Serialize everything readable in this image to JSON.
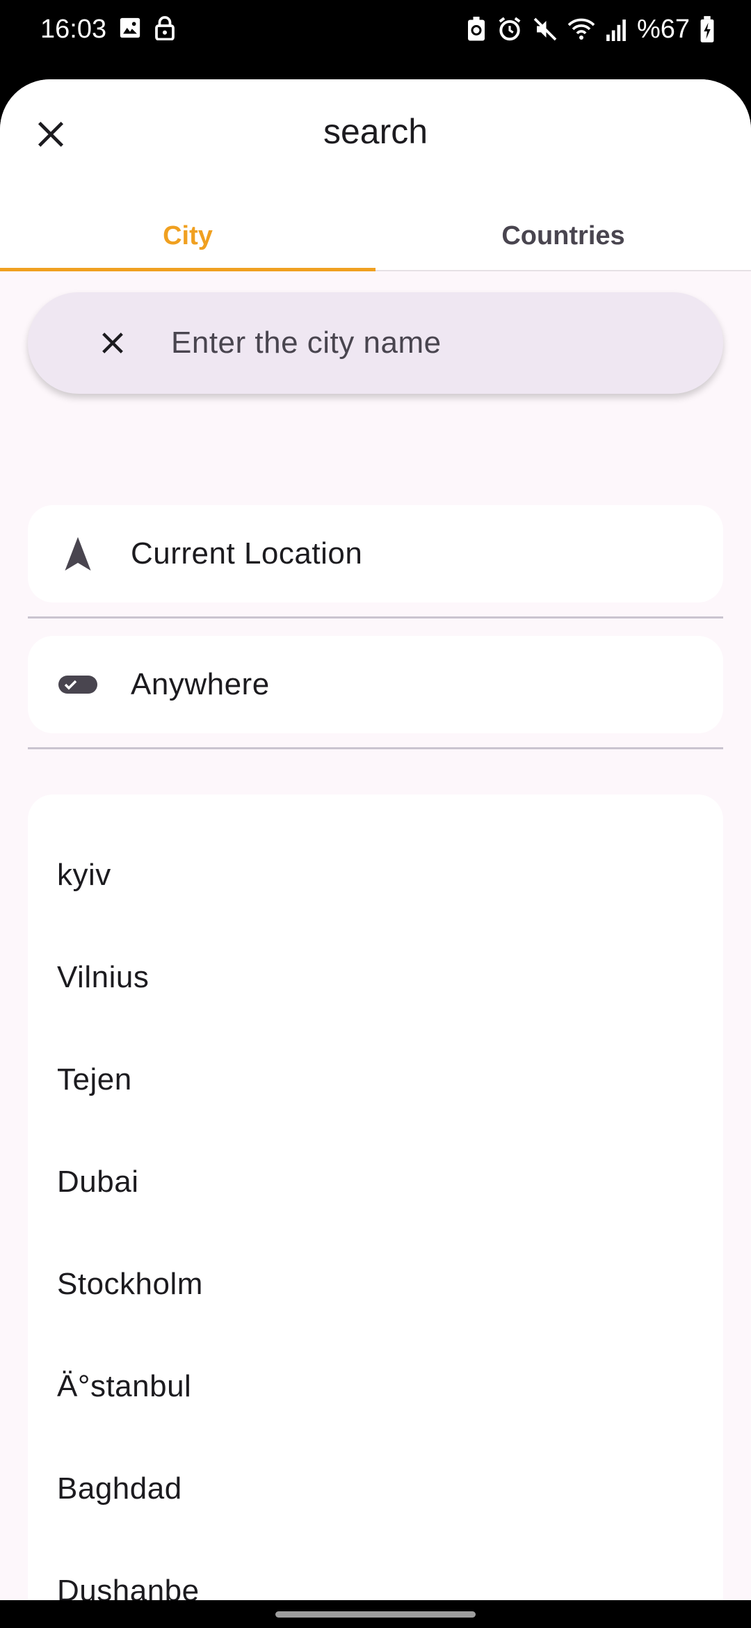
{
  "status_bar": {
    "time": "16:03",
    "battery": "%67",
    "left_icons": [
      "image-icon",
      "lock-icon"
    ],
    "right_icons": [
      "data-saver-icon",
      "alarm-icon",
      "mute-icon",
      "wifi-icon",
      "signal-icon",
      "battery-charging-icon"
    ]
  },
  "sheet": {
    "title": "search",
    "close_icon": "close-icon"
  },
  "tabs": [
    {
      "label": "City",
      "active": true
    },
    {
      "label": "Countries",
      "active": false
    }
  ],
  "search": {
    "placeholder": "Enter the city name",
    "value": "",
    "clear_icon": "close-icon"
  },
  "options": [
    {
      "label": "Current Location",
      "icon": "navigation-arrow-icon"
    },
    {
      "label": "Anywhere",
      "icon": "toggle-icon"
    }
  ],
  "cities": [
    "kyiv",
    "Vilnius",
    "Tejen",
    "Dubai",
    "Stockholm",
    "Ä°stanbul",
    "Baghdad",
    "Dushanbe"
  ],
  "colors": {
    "accent": "#f0a020",
    "sheet_background": "#fdf7fb",
    "search_background": "#efe7f2",
    "text": "#1c1b1f"
  }
}
